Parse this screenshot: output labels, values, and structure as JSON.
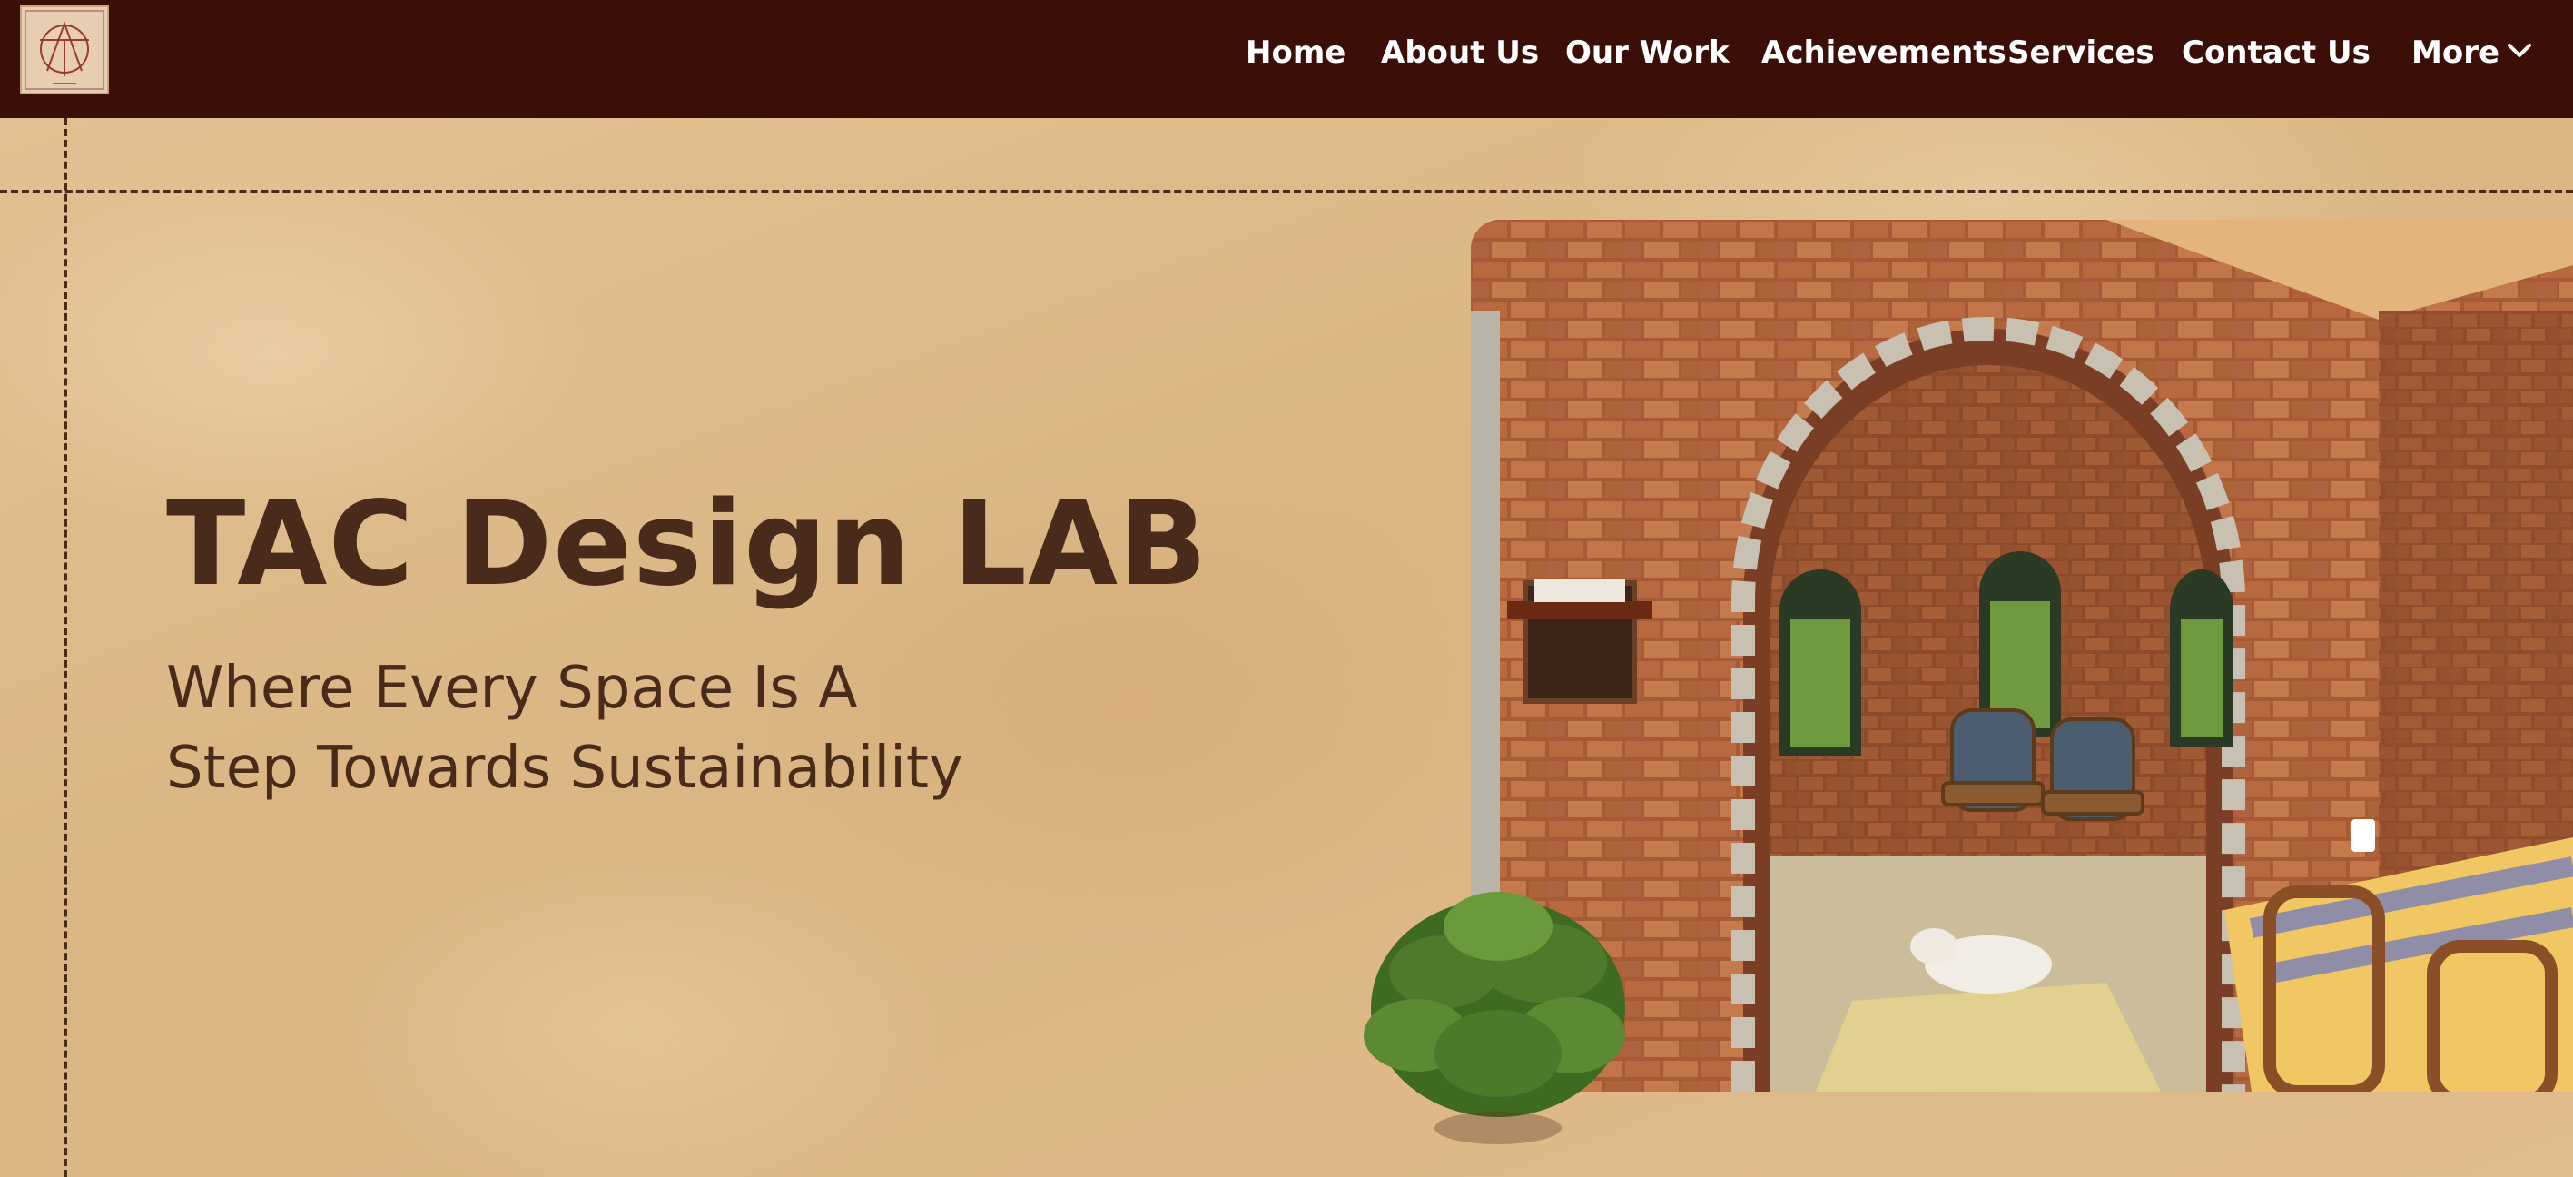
{
  "nav": {
    "logo_icon": "tac-design-lab-logo",
    "items": [
      {
        "label": "Home"
      },
      {
        "label": "About Us"
      },
      {
        "label": "Our Work"
      },
      {
        "label": "Achievements"
      },
      {
        "label": "Services"
      },
      {
        "label": "Contact Us"
      },
      {
        "label": "More"
      }
    ],
    "more_icon": "chevron-down-icon"
  },
  "hero": {
    "title": "TAC Design LAB",
    "subtitle_line1": "Where Every Space Is A",
    "subtitle_line2": "Step Towards Sustainability",
    "photo_icon": "brick-arch-interior-photo",
    "plant_icon": "potted-plant-image"
  },
  "colors": {
    "nav_bg": "#3b0f08",
    "paper_bg": "#deb889",
    "heading_text": "#4a2a1a",
    "nav_text": "#ffffff",
    "dash_line": "#4b2a1a"
  }
}
